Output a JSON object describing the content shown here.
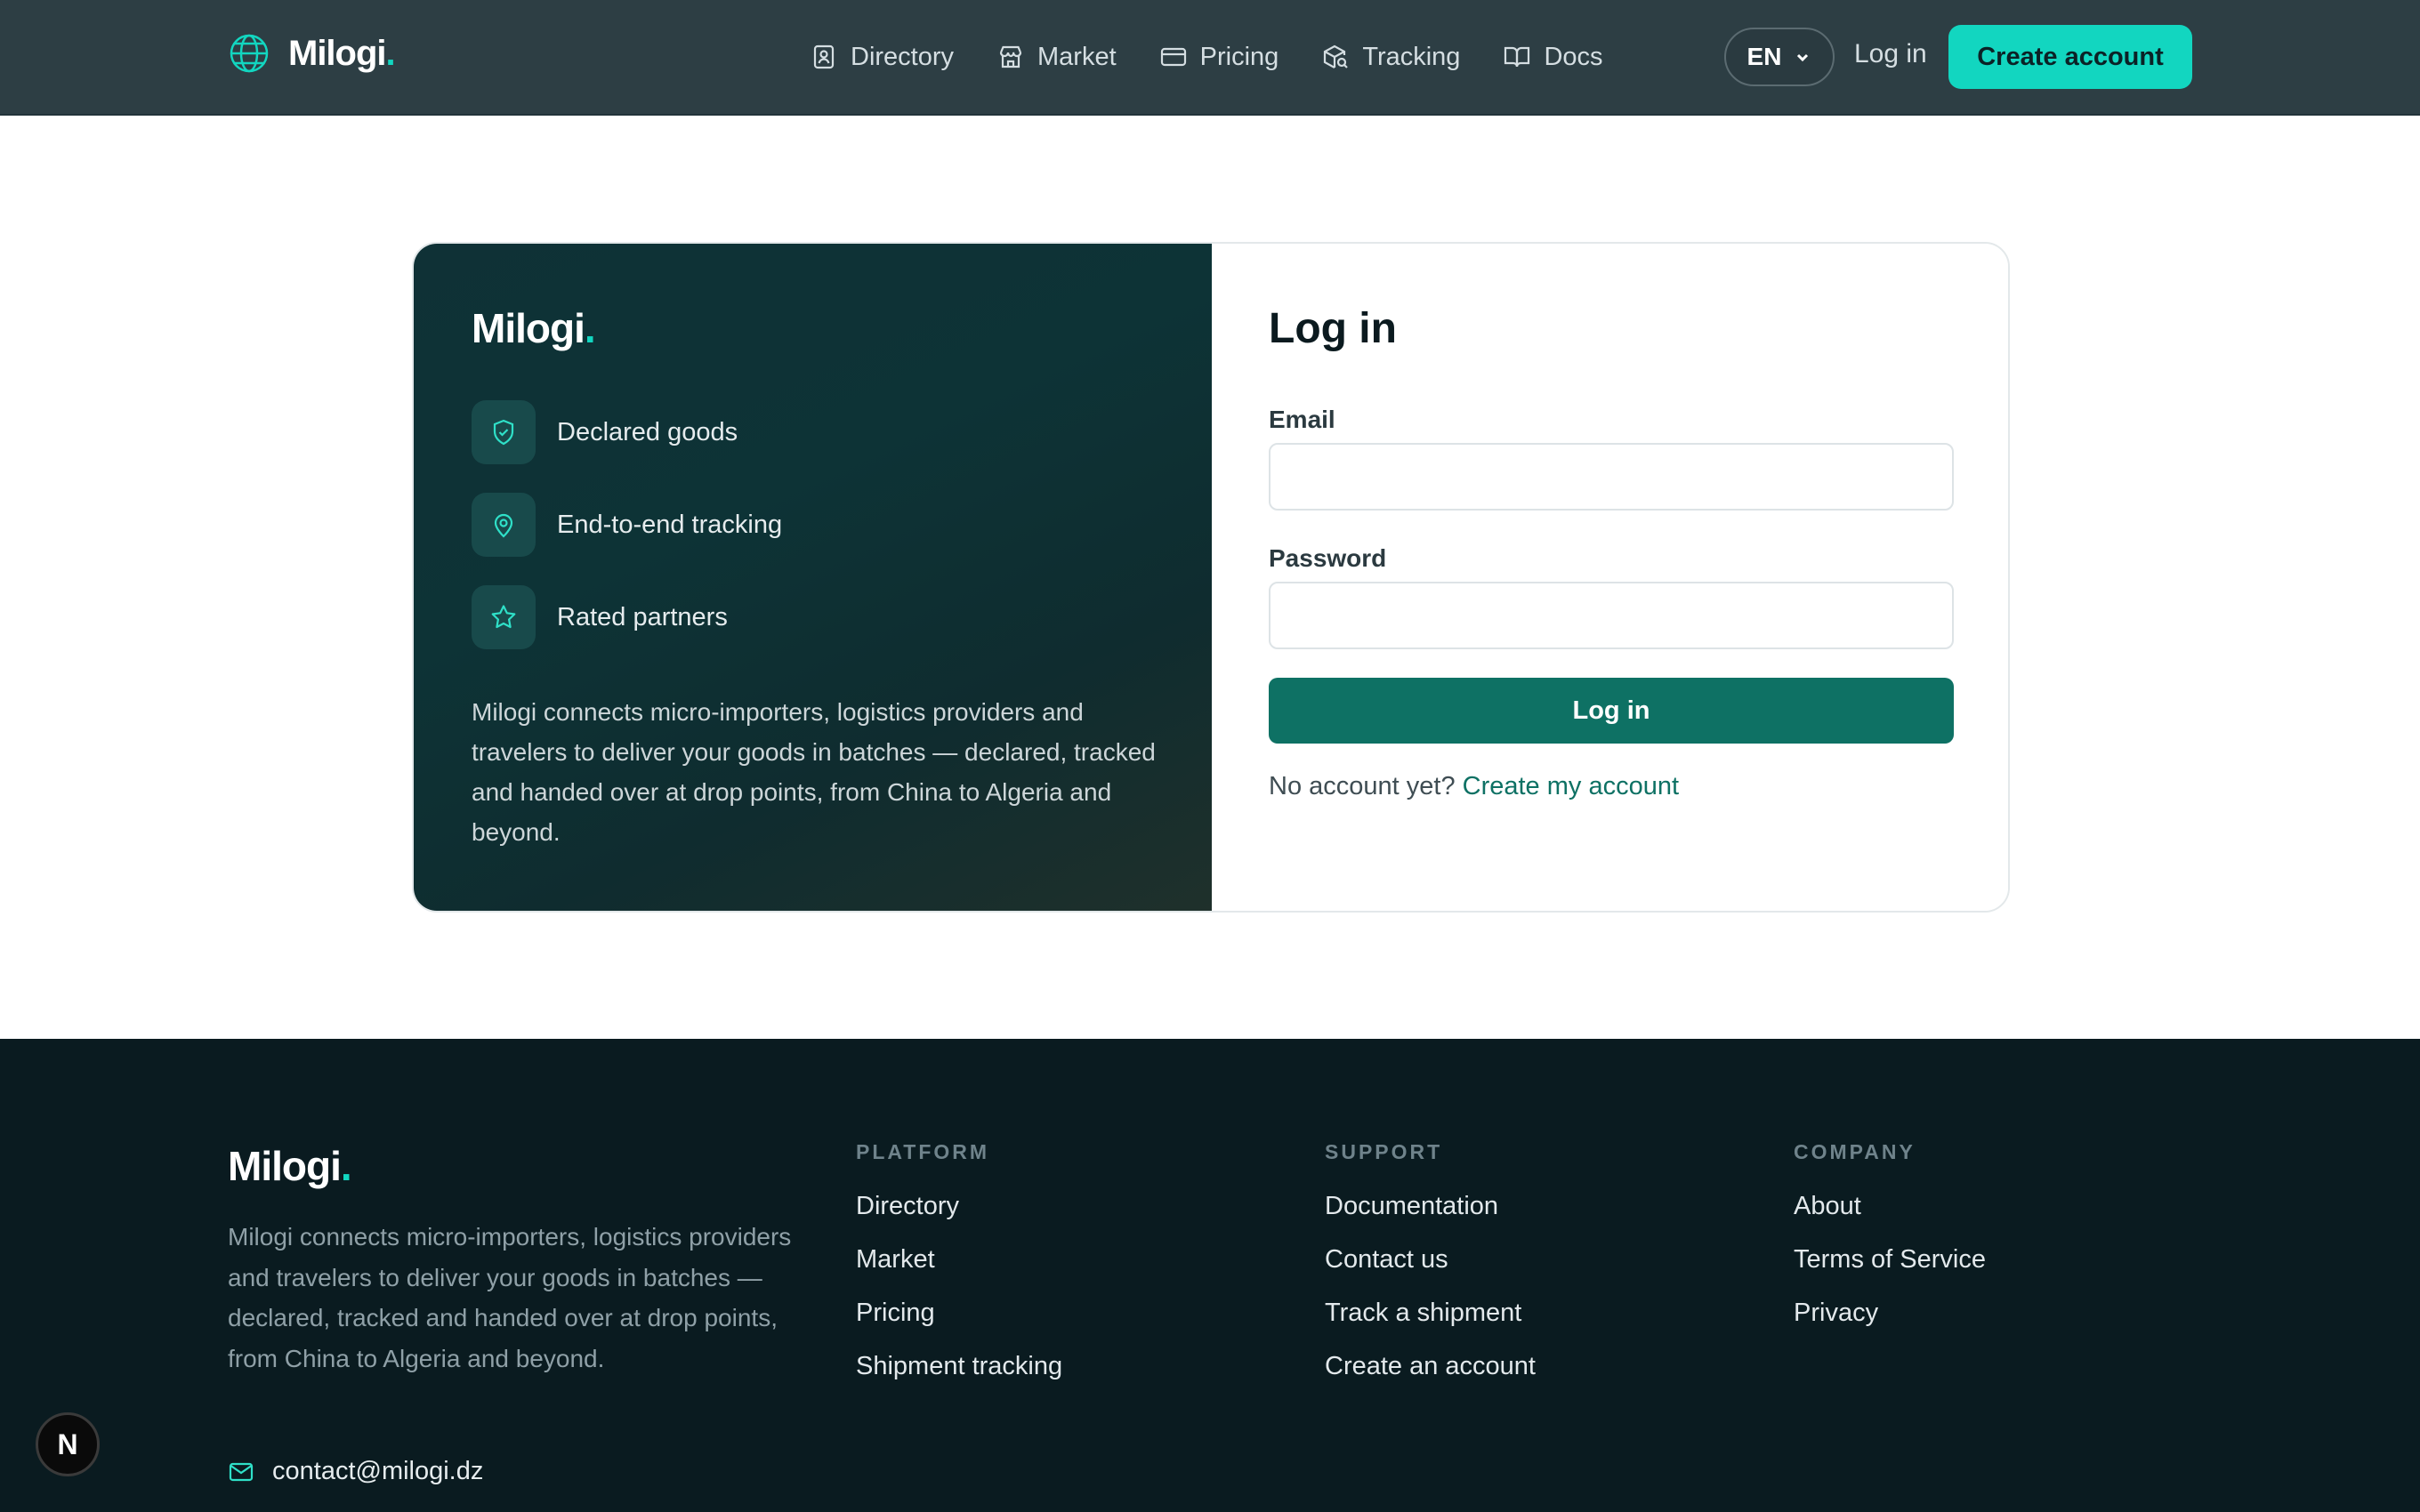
{
  "brand": {
    "name": "Milogi",
    "dot": "."
  },
  "nav": {
    "items": [
      {
        "label": "Directory",
        "icon": "contact-book-icon"
      },
      {
        "label": "Market",
        "icon": "store-icon"
      },
      {
        "label": "Pricing",
        "icon": "credit-card-icon"
      },
      {
        "label": "Tracking",
        "icon": "package-search-icon"
      },
      {
        "label": "Docs",
        "icon": "open-book-icon"
      }
    ],
    "language": "EN",
    "login_label": "Log in",
    "create_account_label": "Create account"
  },
  "promo": {
    "features": [
      {
        "label": "Declared goods",
        "icon": "shield-check-icon"
      },
      {
        "label": "End-to-end tracking",
        "icon": "map-pin-icon"
      },
      {
        "label": "Rated partners",
        "icon": "star-icon"
      }
    ],
    "description": "Milogi connects micro-importers, logistics providers and travelers to deliver your goods in batches — declared, tracked and handed over at drop points, from China to Algeria and beyond."
  },
  "login": {
    "title": "Log in",
    "email_label": "Email",
    "email_value": "",
    "password_label": "Password",
    "password_value": "",
    "submit_label": "Log in",
    "no_account_text": "No account yet?",
    "create_link": "Create my account"
  },
  "footer": {
    "description": "Milogi connects micro-importers, logistics providers and travelers to deliver your goods in batches — declared, tracked and handed over at drop points, from China to Algeria and beyond.",
    "contact_email": "contact@milogi.dz",
    "columns": [
      {
        "title": "PLATFORM",
        "links": [
          "Directory",
          "Market",
          "Pricing",
          "Shipment tracking"
        ]
      },
      {
        "title": "SUPPORT",
        "links": [
          "Documentation",
          "Contact us",
          "Track a shipment",
          "Create an account"
        ]
      },
      {
        "title": "COMPANY",
        "links": [
          "About",
          "Terms of Service",
          "Privacy"
        ]
      }
    ]
  },
  "badge": "N",
  "colors": {
    "accent": "#12d6c0",
    "primary": "#0e7164",
    "nav_bg": "#2d3e44",
    "footer_bg": "#0a1b20"
  }
}
